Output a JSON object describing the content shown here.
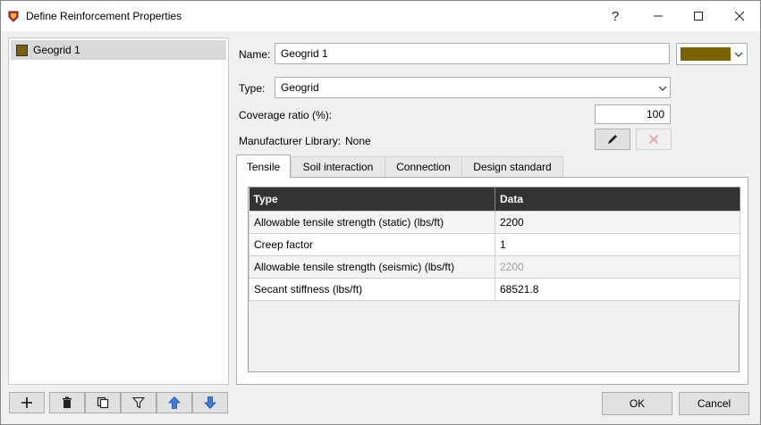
{
  "window": {
    "title": "Define Reinforcement Properties",
    "help": "?",
    "colors": {
      "swatch": "#7a6300",
      "header": "#333333"
    }
  },
  "list": {
    "items": [
      {
        "label": "Geogrid 1"
      }
    ]
  },
  "toolbar": {
    "icons": [
      "plus-icon",
      "trash-icon",
      "copy-icon",
      "filter-icon",
      "arrow-up-icon",
      "arrow-down-icon"
    ]
  },
  "form": {
    "name_label": "Name:",
    "name_value": "Geogrid 1",
    "type_label": "Type:",
    "type_value": "Geogrid",
    "coverage_label": "Coverage ratio (%):",
    "coverage_value": "100",
    "library_label": "Manufacturer Library:",
    "library_value": "None"
  },
  "tabs": [
    "Tensile",
    "Soil interaction",
    "Connection",
    "Design standard"
  ],
  "table": {
    "headers": [
      "Type",
      "Data"
    ],
    "rows": [
      {
        "type": "Allowable tensile strength (static) (lbs/ft)",
        "data": "2200"
      },
      {
        "type": "Creep factor",
        "data": "1"
      },
      {
        "type": "Allowable tensile strength (seismic) (lbs/ft)",
        "data": "2200"
      },
      {
        "type": "Secant stiffness (lbs/ft)",
        "data": "68521.8"
      }
    ]
  },
  "buttons": {
    "ok": "OK",
    "cancel": "Cancel"
  }
}
